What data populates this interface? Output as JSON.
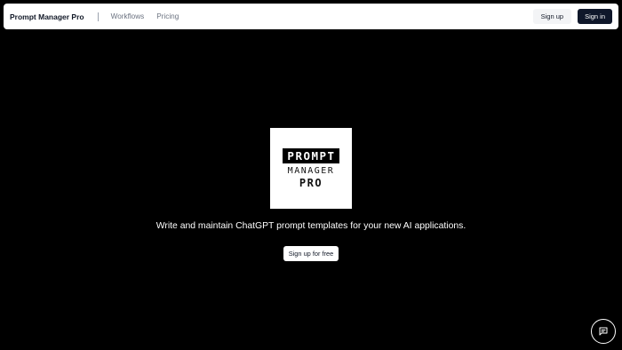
{
  "navbar": {
    "brand": "Prompt Manager Pro",
    "links": [
      "Workflows",
      "Pricing"
    ],
    "sign_up": "Sign up",
    "sign_in": "Sign in"
  },
  "hero": {
    "logo": {
      "line1": "PROMPT",
      "line2": "MANAGER",
      "line3": "PRO"
    },
    "tagline": "Write and maintain ChatGPT prompt templates for your new AI applications.",
    "cta": "Sign up for free"
  },
  "icons": {
    "chat": "chat-bubble-icon"
  },
  "colors": {
    "background": "#000000",
    "nav_background": "#ffffff",
    "primary_button": "#0f172a"
  }
}
